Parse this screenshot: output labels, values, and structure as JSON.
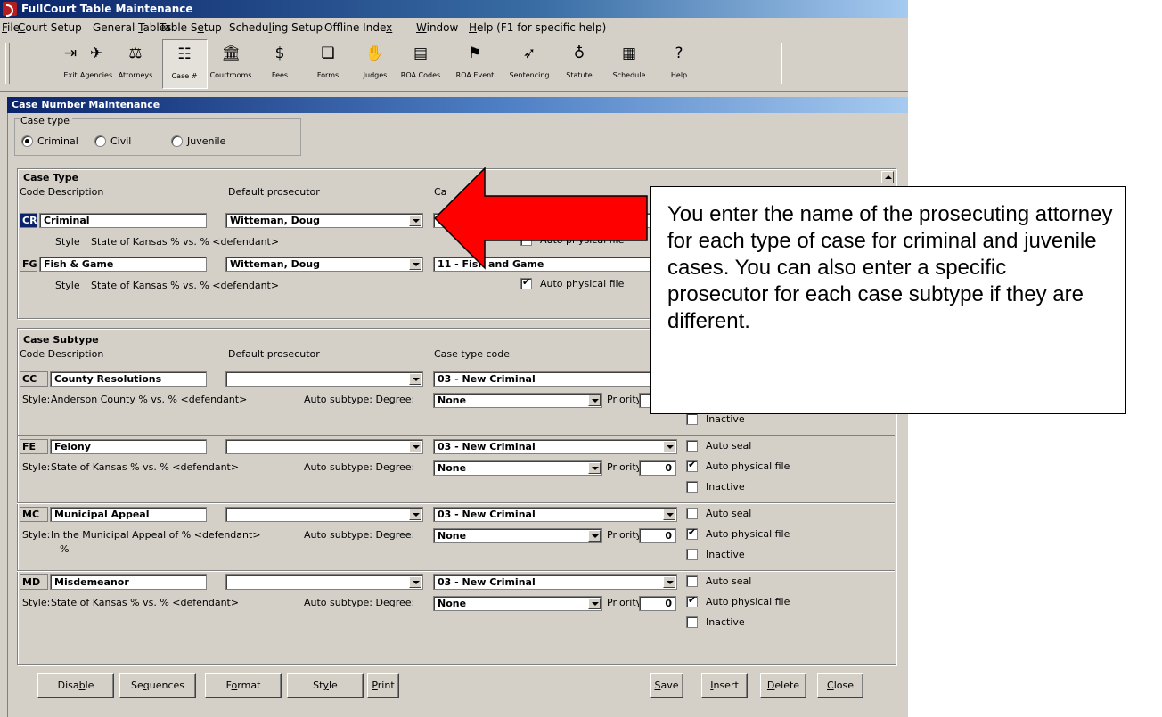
{
  "window": {
    "title": "FullCourt Table Maintenance"
  },
  "menu": [
    {
      "pre": "",
      "acc": "F",
      "post": "ile"
    },
    {
      "pre": "",
      "acc": "C",
      "post": "ourt Setup"
    },
    {
      "pre": "General ",
      "acc": "T",
      "post": "ables"
    },
    {
      "pre": "Table S",
      "acc": "e",
      "post": "tup"
    },
    {
      "pre": "Schedu",
      "acc": "l",
      "post": "ing Setup"
    },
    {
      "pre": "Offline Inde",
      "acc": "x",
      "post": ""
    },
    {
      "pre": "",
      "acc": "W",
      "post": "indow"
    },
    {
      "pre": "",
      "acc": "H",
      "post": "elp (F1 for specific help)"
    }
  ],
  "toolbar": [
    {
      "label": "Exit",
      "icon": "exit-icon",
      "glyph": "⇥"
    },
    {
      "label": "Agencies",
      "icon": "agencies-icon",
      "glyph": "✈"
    },
    {
      "label": "Attorneys",
      "icon": "attorneys-icon",
      "glyph": "⚖"
    },
    {
      "label": "Case #",
      "icon": "case-number-icon",
      "glyph": "☷"
    },
    {
      "label": "Courtrooms",
      "icon": "courtrooms-icon",
      "glyph": "🏛"
    },
    {
      "label": "Fees",
      "icon": "fees-icon",
      "glyph": "$"
    },
    {
      "label": "Forms",
      "icon": "forms-icon",
      "glyph": "❏"
    },
    {
      "label": "Judges",
      "icon": "judges-icon",
      "glyph": "✋"
    },
    {
      "label": "ROA Codes",
      "icon": "roa-codes-icon",
      "glyph": "▤"
    },
    {
      "label": "ROA Event",
      "icon": "roa-event-icon",
      "glyph": "⚑"
    },
    {
      "label": "Sentencing",
      "icon": "sentencing-icon",
      "glyph": "➶"
    },
    {
      "label": "Statute",
      "icon": "statute-icon",
      "glyph": "♁"
    },
    {
      "label": "Schedule",
      "icon": "schedule-icon",
      "glyph": "▦"
    },
    {
      "label": "Help",
      "icon": "help-icon",
      "glyph": "?"
    }
  ],
  "panel": {
    "title": "Case Number Maintenance"
  },
  "case_type_group": {
    "legend": "Case type",
    "options": [
      "Criminal",
      "Civil",
      "Juvenile"
    ],
    "selected": "Criminal"
  },
  "case_type_section": {
    "heading": "Case Type",
    "col_code_desc": "Code Description",
    "col_prosecutor": "Default prosecutor",
    "col_case": "Ca",
    "rows": [
      {
        "code": "CR",
        "description": "Criminal",
        "prosecutor": "Witteman, Doug",
        "case_type_code": "0",
        "style_label": "Style",
        "style": "State of Kansas % vs. % <defendant>",
        "auto_physical_file_label": "Auto physical file",
        "auto_physical_file": true
      },
      {
        "code": "FG",
        "description": "Fish & Game",
        "prosecutor": "Witteman, Doug",
        "case_type_code": "11 - Fish and Game",
        "style_label": "Style",
        "style": "State of Kansas % vs. % <defendant>",
        "auto_physical_file_label": "Auto physical file",
        "auto_physical_file": true
      }
    ]
  },
  "case_subtype_section": {
    "heading": "Case Subtype",
    "col_code_desc": "Code Description",
    "col_prosecutor": "Default prosecutor",
    "col_case": "Case type code",
    "style_label": "Style:",
    "auto_subtype_label": "Auto subtype: Degree:",
    "priority_label": "Priority:",
    "auto_seal_label": "Auto seal",
    "auto_physical_file_label": "Auto physical file",
    "inactive_label": "Inactive",
    "rows": [
      {
        "code": "CC",
        "description": "County Resolutions",
        "prosecutor": "",
        "case_type_code": "03 - New Criminal",
        "style": "Anderson County % vs. % <defendant>",
        "style2": "",
        "degree": "None",
        "priority": "",
        "auto_seal": false,
        "auto_physical_file": false,
        "inactive": false
      },
      {
        "code": "FE",
        "description": "Felony",
        "prosecutor": "",
        "case_type_code": "03 - New Criminal",
        "style": "State of Kansas % vs. % <defendant>",
        "style2": "",
        "degree": "None",
        "priority": "0",
        "auto_seal": false,
        "auto_physical_file": true,
        "inactive": false
      },
      {
        "code": "MC",
        "description": "Municipal Appeal",
        "prosecutor": "",
        "case_type_code": "03 - New Criminal",
        "style": "In the Municipal Appeal of  % <defendant>",
        "style2": "%",
        "degree": "None",
        "priority": "0",
        "auto_seal": false,
        "auto_physical_file": true,
        "inactive": false
      },
      {
        "code": "MD",
        "description": "Misdemeanor",
        "prosecutor": "",
        "case_type_code": "03 - New Criminal",
        "style": "State of Kansas % vs. % <defendant>",
        "style2": "",
        "degree": "None",
        "priority": "0",
        "auto_seal": false,
        "auto_physical_file": true,
        "inactive": false
      }
    ]
  },
  "buttons_left": [
    {
      "name": "disable-button",
      "pre": "Disa",
      "acc": "b",
      "post": "le"
    },
    {
      "name": "sequences-button",
      "pre": "Se",
      "acc": "q",
      "post": "uences"
    },
    {
      "name": "format-button",
      "pre": "F",
      "acc": "o",
      "post": "rmat"
    },
    {
      "name": "style-button",
      "pre": "St",
      "acc": "y",
      "post": "le"
    },
    {
      "name": "print-button",
      "pre": "",
      "acc": "P",
      "post": "rint"
    }
  ],
  "buttons_right": [
    {
      "name": "save-button",
      "pre": "",
      "acc": "S",
      "post": "ave"
    },
    {
      "name": "insert-button",
      "pre": "",
      "acc": "I",
      "post": "nsert"
    },
    {
      "name": "delete-button",
      "pre": "",
      "acc": "D",
      "post": "elete"
    },
    {
      "name": "close-button",
      "pre": "",
      "acc": "C",
      "post": "lose"
    }
  ],
  "annotation": {
    "text": "You enter the name of the prosecuting attorney for each type of case for criminal and juvenile cases. You can also enter a specific prosecutor for each case subtype if they are different.",
    "arrow_color": "#ff0000"
  }
}
